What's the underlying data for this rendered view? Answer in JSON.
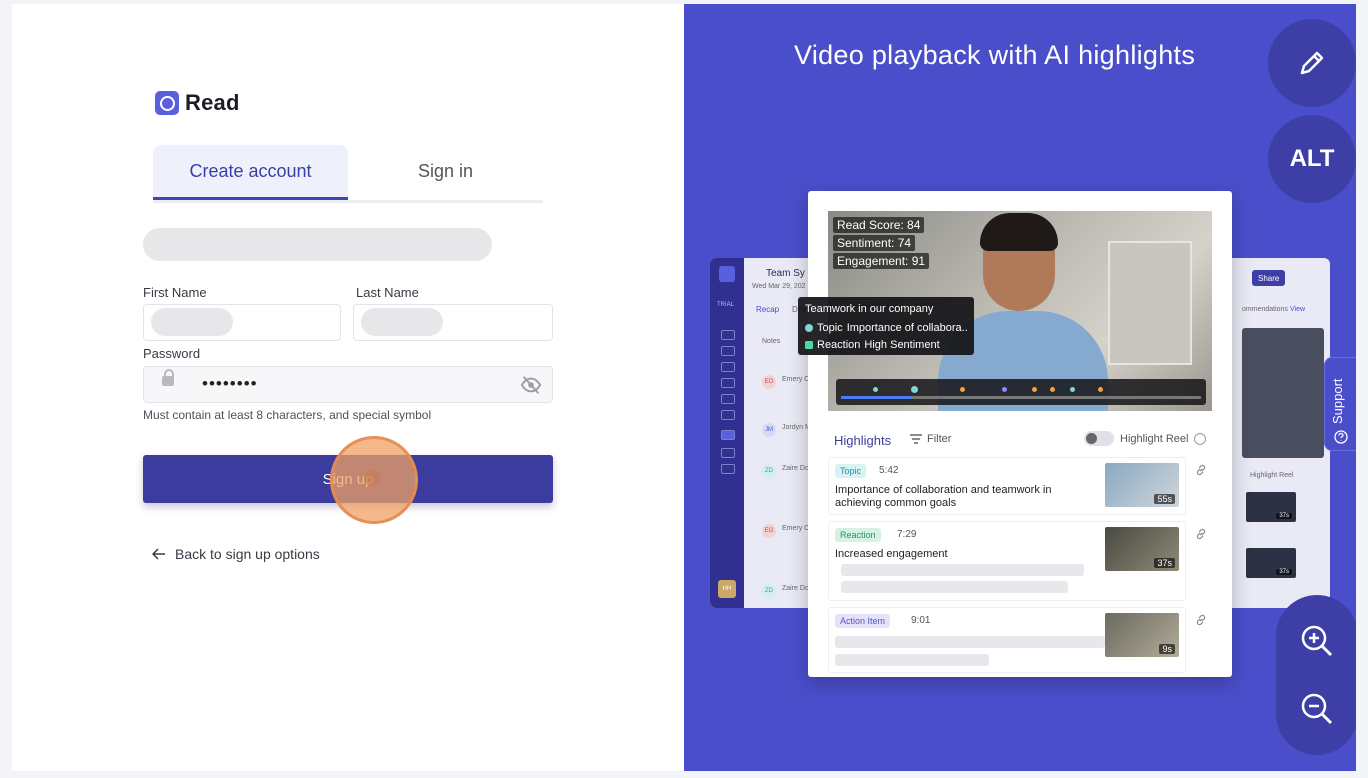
{
  "logo": {
    "text": "Read"
  },
  "tabs": {
    "create": "Create account",
    "signin": "Sign in"
  },
  "form": {
    "first_name_label": "First Name",
    "last_name_label": "Last Name",
    "password_label": "Password",
    "password_value": "••••••••",
    "password_hint": "Must contain at least 8 characters, and special symbol",
    "signup_label": "Sign up",
    "back_label": "Back to sign up options"
  },
  "promo": {
    "heading": "Video playback with AI highlights",
    "alt_label": "ALT",
    "support_label": "Support"
  },
  "video": {
    "read_score": "Read Score: 84",
    "sentiment": "Sentiment: 74",
    "engagement": "Engagement: 91",
    "tooltip_title": "Teamwork in our company",
    "tooltip_topic_label": "Topic",
    "tooltip_topic_text": "Importance of collabora..",
    "tooltip_reaction_label": "Reaction",
    "tooltip_reaction_text": "High Sentiment"
  },
  "highlights": {
    "title": "Highlights",
    "filter": "Filter",
    "reel": "Highlight Reel",
    "items": [
      {
        "chip": "Topic",
        "time": "5:42",
        "text": "Importance of collaboration and teamwork in achieving common goals",
        "duration": "55s"
      },
      {
        "chip": "Reaction",
        "time": "7:29",
        "text": "Increased engagement",
        "duration": "37s"
      },
      {
        "chip": "Action Item",
        "time": "9:01",
        "text": "",
        "duration": "9s"
      }
    ]
  },
  "bgapp": {
    "title": "Team Sy",
    "date": "Wed Mar 29, 202",
    "tab_recap": "Recap",
    "tab_deep": "Deep",
    "notes": "Notes",
    "trial": "TRIAL",
    "share": "Share",
    "recommendations": "ommendations",
    "view": "View",
    "reel": "Highlight Reel",
    "avatar_hh": "HH",
    "speakers": [
      {
        "initials": "EO",
        "name": "Emery C"
      },
      {
        "initials": "JM",
        "name": "Jordyn M"
      },
      {
        "initials": "ZD",
        "name": "Zaire Dc"
      },
      {
        "initials": "EG",
        "name": "Emery C"
      },
      {
        "initials": "ZD",
        "name": "Zaire Dc"
      }
    ],
    "thumb_durations": [
      "37s",
      "37s"
    ]
  },
  "colors": {
    "accent": "#3b3c9d",
    "promo_bg": "#4b4ecb",
    "tab_active": "#3a3fa8"
  }
}
